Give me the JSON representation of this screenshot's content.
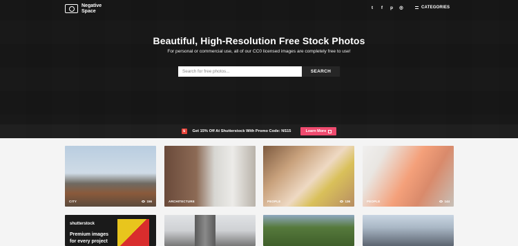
{
  "header": {
    "logo_line1": "Negative",
    "logo_line2": "Space",
    "social": [
      {
        "icon": "twitter-icon",
        "glyph": "t"
      },
      {
        "icon": "facebook-icon",
        "glyph": "f"
      },
      {
        "icon": "pinterest-icon",
        "glyph": "p"
      },
      {
        "icon": "instagram-icon",
        "glyph": "◎"
      }
    ],
    "categories_label": "CATEGORIES"
  },
  "hero": {
    "title": "Beautiful, High-Resolution Free Stock Photos",
    "subtitle": "For personal or commercial use, all of our CC0 licensed images are completely free to use!",
    "search_placeholder": "Search for free photos...",
    "search_button": "SEARCH"
  },
  "promo": {
    "text": "Get 15% Off At Shutterstock With Promo Code: NS15",
    "button": "Learn More",
    "accent": "#ef4b6f"
  },
  "photos": [
    {
      "tag": "CITY",
      "views": "156"
    },
    {
      "tag": "ARCHITECTURE",
      "views": ""
    },
    {
      "tag": "PEOPLE",
      "views": "136"
    },
    {
      "tag": "PEOPLE",
      "views": "144"
    }
  ],
  "ad": {
    "brand": "shutterstock",
    "line1": "Premium images",
    "line2": "for every project"
  }
}
